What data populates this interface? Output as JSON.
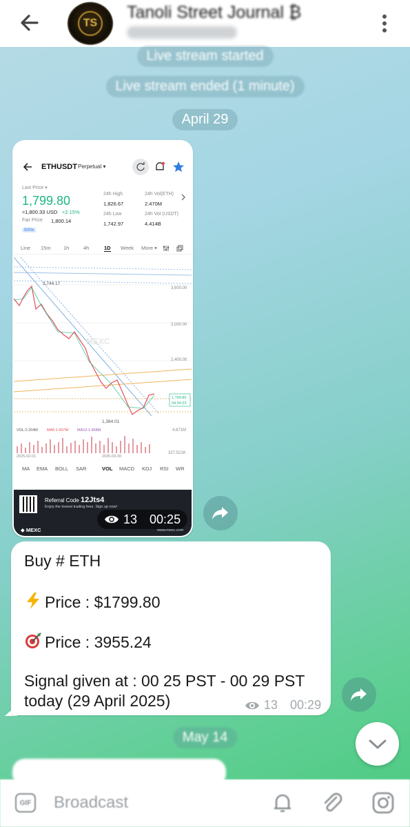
{
  "header": {
    "title": "Tanoli Street Journal",
    "title_symbol": "₿",
    "avatar_monogram": "TS",
    "icons": {
      "back": "arrow-left-icon",
      "menu": "more-vertical-icon"
    }
  },
  "service": {
    "stream_started": "Live stream started",
    "stream_ended": "Live stream ended (1 minute)",
    "date_april": "April 29",
    "date_may": "May 14"
  },
  "image_message": {
    "views": "13",
    "time": "00:25",
    "screenshot": {
      "pair": "ETHUSDT",
      "pair_type": "Perpetual",
      "last_price_label": "Last Price",
      "last_price": "1,799.80",
      "usd_line": "≈1,800.33 USD",
      "change": "+2.15%",
      "fair_price_label": "Fair Price",
      "fair_price": "1,800.14",
      "leverage": "500x",
      "high_label": "24h High",
      "high": "1,826.67",
      "low_label": "24h Low",
      "low": "1,742.97",
      "vol_eth_label": "24h Vol(ETH)",
      "vol_eth": "2.470M",
      "vol_usdt_label": "24h Vol (USDT)",
      "vol_usdt": "4.414B",
      "tabs": [
        "Line",
        "15m",
        "1h",
        "4h",
        "1D",
        "Week",
        "More"
      ],
      "active_tab": "1D",
      "chart_high": "3,744.17",
      "chart_low": "1,384.01",
      "axis_labels": [
        "3,600.00",
        "3,000.00",
        "2,400.00",
        "4.671M",
        "327.521K"
      ],
      "price_tag": "1,799.80",
      "countdown": "04:34:23",
      "watermark": "MEXC",
      "vol_legend": "VOL:2.204M",
      "ma5": "MA5:1.607M",
      "ma10": "MA10:1.958M",
      "date_1": "2025-02-01",
      "date_2": "2025-03-30",
      "indicators": [
        "MA",
        "EMA",
        "BOLL",
        "SAR",
        "VOL",
        "MACD",
        "KDJ",
        "RSI",
        "WR"
      ],
      "active_indicator": "VOL",
      "referral_label": "Referral Code",
      "referral_code": "12Jts4",
      "referral_sub": "Enjoy the lowest trading fees. Sign up now!",
      "brand": "MEXC",
      "url": "www.mexc.com"
    }
  },
  "text_message": {
    "line1": "Buy # ETH",
    "line2": "Price : $1799.80",
    "line3": "Price : 3955.24",
    "line4": "Signal given at : 00 25 PST - 00 29 PST",
    "line5": "today (29 April 2025)",
    "views": "13",
    "time": "00:29",
    "emoji_1": "lightning-icon",
    "emoji_2": "target-icon"
  },
  "bottom_bar": {
    "gif_label": "GIF",
    "placeholder": "Broadcast",
    "icons": [
      "bell-icon",
      "paperclip-icon",
      "instagram-icon"
    ]
  },
  "colors": {
    "price_green": "#1db584",
    "accent_blue": "#2f7de1",
    "down_red": "#e0505a"
  }
}
